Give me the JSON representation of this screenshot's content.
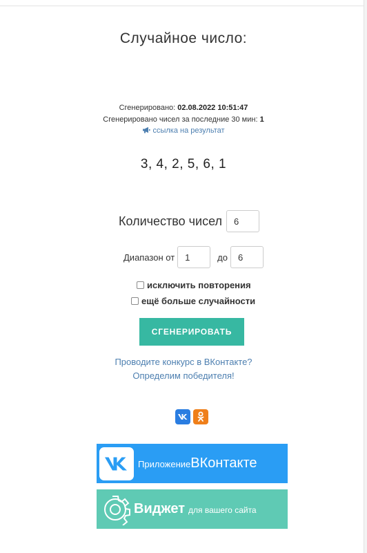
{
  "title": "Случайное число:",
  "meta": {
    "generated_label": "Сгенерировано:",
    "generated_value": "02.08.2022 10:51:47",
    "count_30min_label": "Сгенерировано чисел за последние 30 мин:",
    "count_30min_value": "1",
    "result_link": "ссылка на результат",
    "result_link_icon": "megaphone-icon"
  },
  "result_numbers": "3, 4, 2, 5, 6, 1",
  "form": {
    "count_label": "Количество чисел",
    "count_value": "6",
    "range_label": "Диапазон от",
    "range_from": "1",
    "range_to_label": "до",
    "range_to": "6",
    "checkbox_exclude_label": "исключить повторения",
    "checkbox_exclude_checked": false,
    "checkbox_random_label": "ещё больше случайности",
    "checkbox_random_checked": false,
    "generate_button": "СГЕНЕРИРОВАТЬ"
  },
  "contest": {
    "line1": "Проводите конкурс в ВКонтакте?",
    "line2": "Определим победителя!"
  },
  "social": {
    "vk_icon": "vk-icon",
    "ok_icon": "odnoklassniki-icon"
  },
  "banners": {
    "vk_app_small": "Приложение",
    "vk_app_big": "ВКонтакте",
    "widget_big": "Виджет",
    "widget_small": "для вашего сайта"
  },
  "colors": {
    "accent_button": "#37b8a2",
    "link": "#4d7fb0",
    "vk_blue": "#2a9df4",
    "ok_orange": "#ef7f1a",
    "widget_green": "#5fcab4"
  }
}
